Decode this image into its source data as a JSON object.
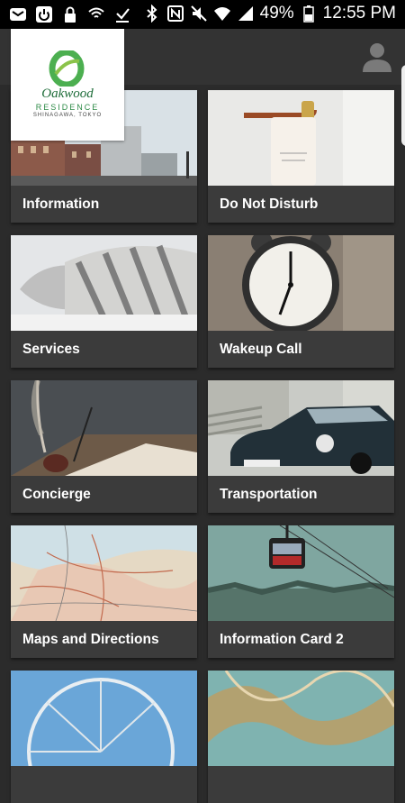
{
  "status_bar": {
    "battery": "49%",
    "time": "12:55 PM"
  },
  "brand": {
    "name": "Oakwood",
    "subtitle": "RESIDENCE",
    "location": "SHINAGAWA, TOKYO"
  },
  "cards": [
    {
      "label": "Information",
      "icon": "city-street-photo"
    },
    {
      "label": "Do Not Disturb",
      "icon": "door-hanger-photo"
    },
    {
      "label": "Services",
      "icon": "pillows-photo"
    },
    {
      "label": "Wakeup Call",
      "icon": "alarm-clock-photo"
    },
    {
      "label": "Concierge",
      "icon": "quill-pen-photo"
    },
    {
      "label": "Transportation",
      "icon": "classic-car-photo"
    },
    {
      "label": "Maps and Directions",
      "icon": "map-photo"
    },
    {
      "label": "Information Card 2",
      "icon": "cable-car-photo"
    },
    {
      "label": "",
      "icon": "ferris-wheel-photo"
    },
    {
      "label": "",
      "icon": "abstract-photo"
    }
  ],
  "colors": {
    "background": "#2b2b2b",
    "card": "#3b3b3b",
    "brand_green": "#2e8b47"
  }
}
